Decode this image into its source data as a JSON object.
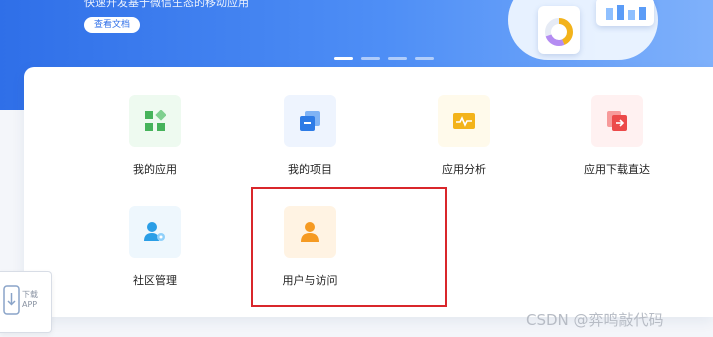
{
  "banner": {
    "subtitle": "快速开发基于微信生态的移动应用",
    "doc_button": "查看文档",
    "carousel_dots": 4,
    "carousel_active": 1
  },
  "apps": [
    {
      "label": "我的应用",
      "icon": "apps-grid-icon",
      "bg": "#eefaf0",
      "color": "#46b35b"
    },
    {
      "label": "我的项目",
      "icon": "project-stack-icon",
      "bg": "#eef4fe",
      "color": "#2d7be6"
    },
    {
      "label": "应用分析",
      "icon": "analytics-pulse-icon",
      "bg": "#fffaeb",
      "color": "#f3b31a"
    },
    {
      "label": "应用下载直达",
      "icon": "download-direct-icon",
      "bg": "#fff1f1",
      "color": "#ec4a4a"
    },
    {
      "label": "社区管理",
      "icon": "community-user-gear-icon",
      "bg": "#eef7fd",
      "color": "#2a9ee6"
    },
    {
      "label": "用户与访问",
      "icon": "user-access-icon",
      "bg": "#fff3e3",
      "color": "#f59a23"
    }
  ],
  "float_download": {
    "line1": "下载",
    "line2": "APP"
  },
  "watermark": "CSDN @弈鸣敲代码",
  "colors": {
    "highlight": "#d9262b",
    "brand": "#2f6fe8"
  }
}
